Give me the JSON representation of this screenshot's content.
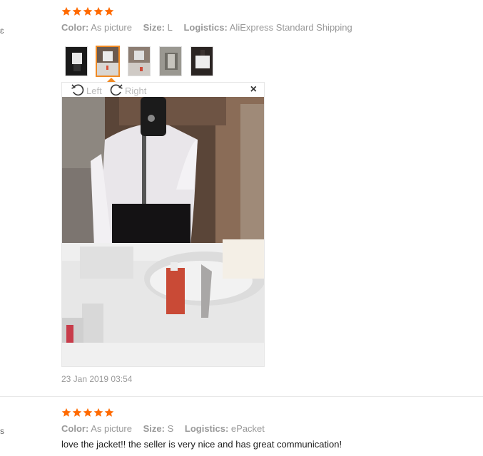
{
  "review1": {
    "rating": 5,
    "color_label": "Color:",
    "color_value": "As picture",
    "size_label": "Size:",
    "size_value": "L",
    "logistics_label": "Logistics:",
    "logistics_value": "AliExpress Standard Shipping",
    "thumbnails": [
      "thumb-1",
      "thumb-2",
      "thumb-3",
      "thumb-4",
      "thumb-5"
    ],
    "active_thumbnail": 2,
    "viewer": {
      "rotate_left_label": "Left",
      "rotate_right_label": "Right",
      "close_label": "×"
    },
    "date": "23 Jan 2019 03:54"
  },
  "review2": {
    "rating": 5,
    "color_label": "Color:",
    "color_value": "As picture",
    "size_label": "Size:",
    "size_value": "S",
    "logistics_label": "Logistics:",
    "logistics_value": "ePacket",
    "comment": "love the jacket!! the seller is very nice and has great communication!"
  },
  "edge_marks": {
    "top": "ɛ",
    "bottom": "s"
  },
  "colors": {
    "star": "#ff6a00",
    "accent": "#f08a24",
    "muted": "#999999"
  }
}
